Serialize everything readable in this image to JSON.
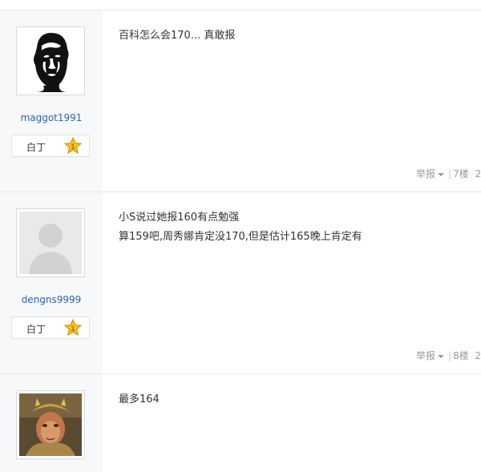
{
  "rank_colors": {
    "star_fill": "#f5c518",
    "star_stroke": "#d48a00",
    "star_text": "#b85c00"
  },
  "posts": [
    {
      "username": "maggot1991",
      "rank_label": "白丁",
      "rank_level": "1",
      "avatar_icon": "bald-man-sketch-avatar",
      "content": [
        "百科怎么会170... 真敢报"
      ],
      "report_label": "举报",
      "floor_label": "7楼",
      "trailing": "2"
    },
    {
      "username": "dengns9999",
      "rank_label": "白丁",
      "rank_level": "1",
      "avatar_icon": "default-user-avatar",
      "content": [
        "小S说过她报160有点勉强",
        "算159吧,周秀娜肯定没170,但是估计165晚上肯定有"
      ],
      "report_label": "举报",
      "floor_label": "8楼",
      "trailing": "2"
    },
    {
      "username": "",
      "rank_label": "",
      "rank_level": "",
      "avatar_icon": "monkey-king-avatar",
      "content": [
        "最多164"
      ],
      "report_label": "",
      "floor_label": "",
      "trailing": ""
    }
  ]
}
